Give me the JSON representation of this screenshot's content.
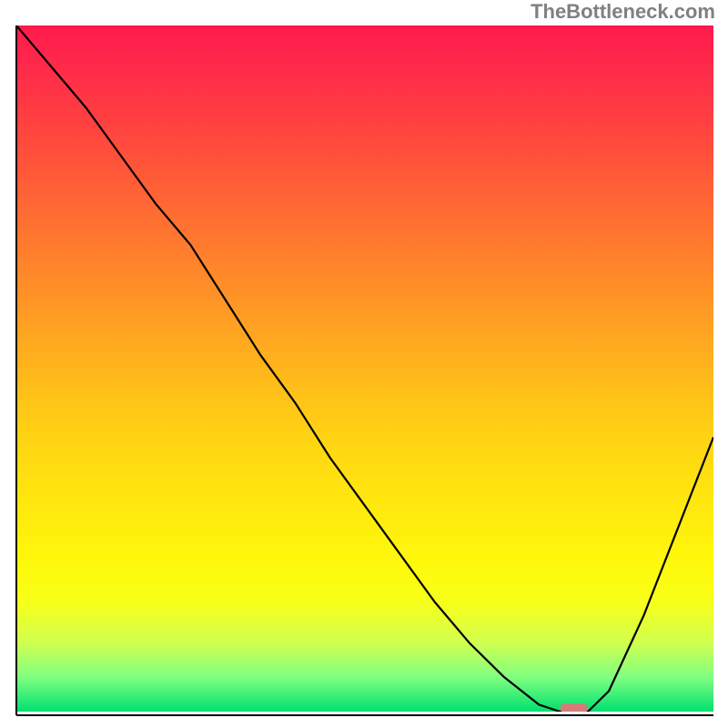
{
  "watermark": "TheBottleneck.com",
  "chart_data": {
    "type": "line",
    "title": "",
    "xlabel": "",
    "ylabel": "",
    "xlim": [
      0,
      100
    ],
    "ylim": [
      0,
      100
    ],
    "x": [
      0,
      5,
      10,
      15,
      20,
      25,
      30,
      35,
      40,
      45,
      50,
      55,
      60,
      65,
      70,
      75,
      78,
      80,
      82,
      85,
      90,
      95,
      100
    ],
    "values": [
      100,
      94,
      88,
      81,
      74,
      68,
      60,
      52,
      45,
      37,
      30,
      23,
      16,
      10,
      5,
      1,
      0,
      0,
      0,
      3,
      14,
      27,
      40
    ],
    "marker": {
      "x_start": 78,
      "x_end": 82,
      "y": 0.5,
      "color": "#d77a7a"
    },
    "grid": false,
    "legend": false
  }
}
